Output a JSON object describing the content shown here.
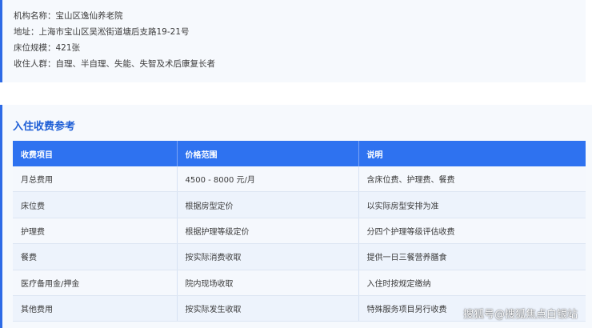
{
  "info": {
    "name_line": "机构名称：宝山区逸仙养老院",
    "address_line": "地址：上海市宝山区吴淞街道塘后支路19-21号",
    "beds_line": "床位规模：421张",
    "residents_line": "收住人群：自理、半自理、失能、失智及术后康复长者"
  },
  "fee_section": {
    "title": "入住收费参考",
    "headers": [
      "收费项目",
      "价格范围",
      "说明"
    ],
    "rows": [
      [
        "月总费用",
        "4500 - 8000 元/月",
        "含床位费、护理费、餐费"
      ],
      [
        "床位费",
        "根据房型定价",
        "以实际房型安排为准"
      ],
      [
        "护理费",
        "根据护理等级定价",
        "分四个护理等级评估收费"
      ],
      [
        "餐费",
        "按实际消费收取",
        "提供一日三餐营养膳食"
      ],
      [
        "医疗备用金/押金",
        "院内现场收取",
        "入住时按规定缴纳"
      ],
      [
        "其他费用",
        "按实际发生收取",
        "特殊服务项目另行收费"
      ]
    ]
  },
  "watermark": "搜狐号@搜狐焦点白银站",
  "colors": {
    "accent": "#2e6be6",
    "header_bg": "#2e72f0",
    "title": "#1f5fd6",
    "card_bg": "#f6f9fd"
  }
}
